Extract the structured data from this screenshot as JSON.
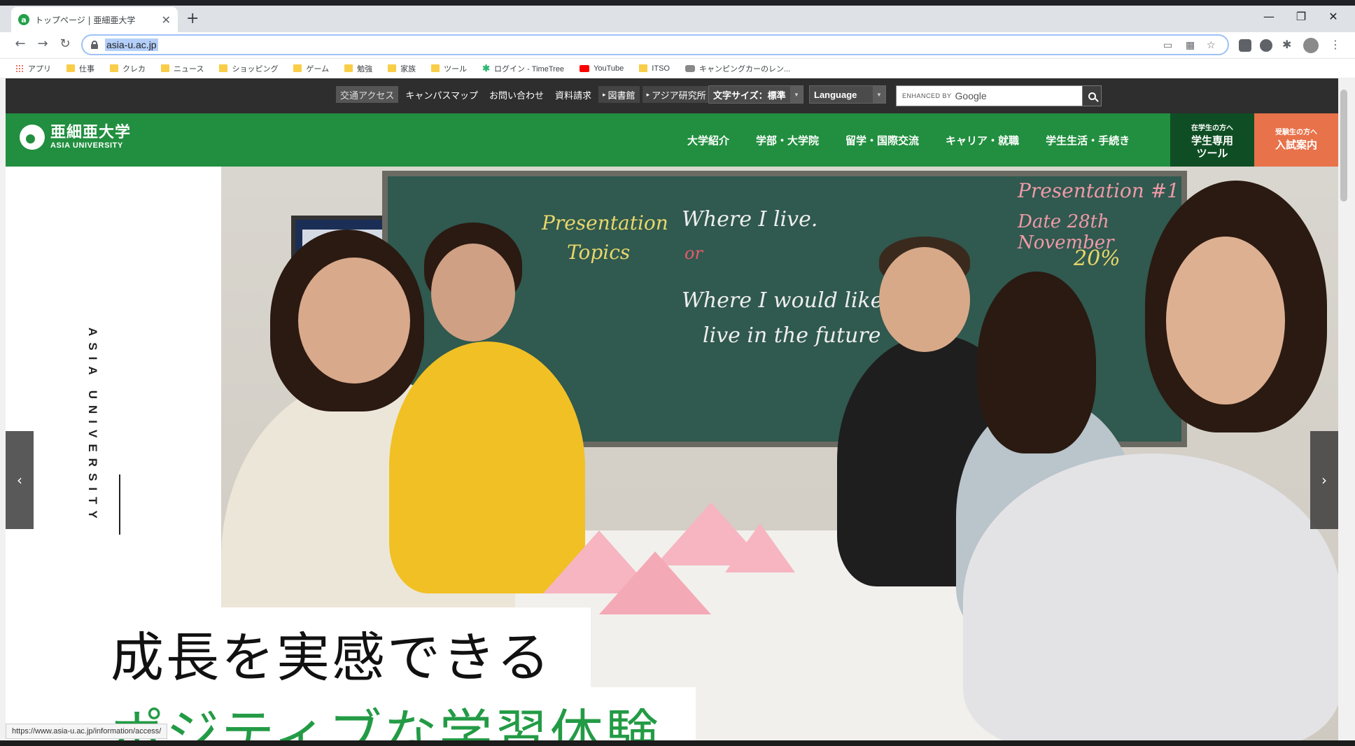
{
  "browser": {
    "tab_title": "トップページ | 亜細亜大学",
    "url": "asia-u.ac.jp",
    "status_url": "https://www.asia-u.ac.jp/information/access/",
    "bookmarks": [
      {
        "label": "アプリ",
        "icon": "apps-grid-icon"
      },
      {
        "label": "仕事",
        "icon": "folder-icon"
      },
      {
        "label": "クレカ",
        "icon": "folder-icon"
      },
      {
        "label": "ニュース",
        "icon": "folder-icon"
      },
      {
        "label": "ショッピング",
        "icon": "folder-icon"
      },
      {
        "label": "ゲーム",
        "icon": "folder-icon"
      },
      {
        "label": "勉強",
        "icon": "folder-icon"
      },
      {
        "label": "家族",
        "icon": "folder-icon"
      },
      {
        "label": "ツール",
        "icon": "folder-icon"
      },
      {
        "label": "ログイン - TimeTree",
        "icon": "timetree-icon"
      },
      {
        "label": "YouTube",
        "icon": "youtube-icon"
      },
      {
        "label": "ITSO",
        "icon": "folder-icon"
      },
      {
        "label": "キャンピングカーのレン...",
        "icon": "camper-icon"
      }
    ]
  },
  "site": {
    "utility_links": [
      "交通アクセス",
      "キャンパスマップ",
      "お問い合わせ",
      "資料請求",
      "図書館",
      "アジア研究所"
    ],
    "font_size_label": "文字サイズ：標準",
    "language_label": "Language",
    "search_enhanced": "ENHANCED BY",
    "search_google": "Google",
    "logo_ja": "亜細亜大学",
    "logo_en": "ASIA UNIVERSITY",
    "menu": [
      "大学紹介",
      "学部・大学院",
      "留学・国際交流",
      "キャリア・就職",
      "学生生活・手続き"
    ],
    "student_tool_small": "在学生の方へ",
    "student_tool_line1": "学生専用",
    "student_tool_line2": "ツール",
    "entrance_small": "受験生の方へ",
    "entrance_label": "入試案内",
    "hero_vertical": "ASIA UNIVERSITY",
    "hero_catch1": "成長を実感できる",
    "hero_catch2": "ポジティブな学習体験",
    "prev_arrow": "‹",
    "next_arrow": "›",
    "board": {
      "line1": "Presentation",
      "line2": "Topics",
      "a_item": "Where I live.",
      "or": "or",
      "b_item1": "Where I would like",
      "b_item2": "live in the future",
      "right1": "Presentation #1",
      "right2": "Date 28th November",
      "right3": "20%"
    }
  },
  "colors": {
    "brand_green": "#218f3f",
    "dark_green": "#0f4e24",
    "orange": "#e8724a",
    "catch_green": "#239b45"
  }
}
